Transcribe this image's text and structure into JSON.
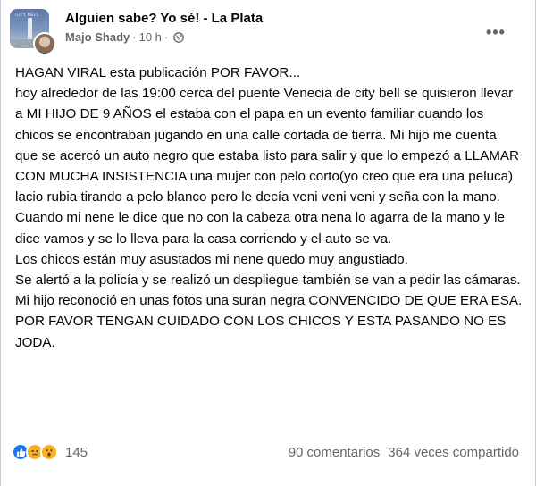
{
  "header": {
    "group_name": "Alguien sabe? Yo sé! - La Plata",
    "author": "Majo Shady",
    "separator": "·",
    "time": "10 h",
    "separator2": "·",
    "privacy_icon": "globe-icon",
    "avatar_overlay_text": "CITY BELL"
  },
  "post": {
    "paragraphs": [
      "HAGAN VIRAL esta publicación POR FAVOR...",
      "hoy alrededor de las 19:00 cerca del puente Venecia de city bell se quisieron llevar a MI HIJO DE 9 AÑOS el estaba con el papa en un evento familiar cuando los chicos se encontraban jugando en una calle cortada de tierra. Mi hijo me cuenta que se acercó un auto negro que estaba listo para salir y que lo empezó a LLAMAR CON MUCHA INSISTENCIA una mujer con pelo corto(yo creo que era una peluca) lacio rubia tirando a pelo blanco pero le decía veni veni veni y seña con la mano. Cuando mi nene le dice que no con la cabeza otra nena lo agarra de la mano y le dice vamos  y se lo lleva para la casa corriendo y el auto se va.",
      "Los chicos están muy asustados mi nene quedo muy angustiado.",
      "Se alertó a la policía y se realizó un despliegue también se van a pedir las cámaras.",
      "Mi hijo reconoció en unas fotos una suran negra CONVENCIDO DE QUE ERA ESA. POR FAVOR TENGAN CUIDADO CON LOS CHICOS Y ESTA PASANDO NO ES JODA."
    ]
  },
  "footer": {
    "reactions": [
      "like-icon",
      "sad-icon",
      "wow-icon"
    ],
    "reaction_count": "145",
    "comments": "90 comentarios",
    "shares": "364 veces compartido"
  },
  "colors": {
    "text_primary": "#050505",
    "text_secondary": "#65676b",
    "like_blue": "#1877f2",
    "reaction_yellow": "#f7b125"
  }
}
